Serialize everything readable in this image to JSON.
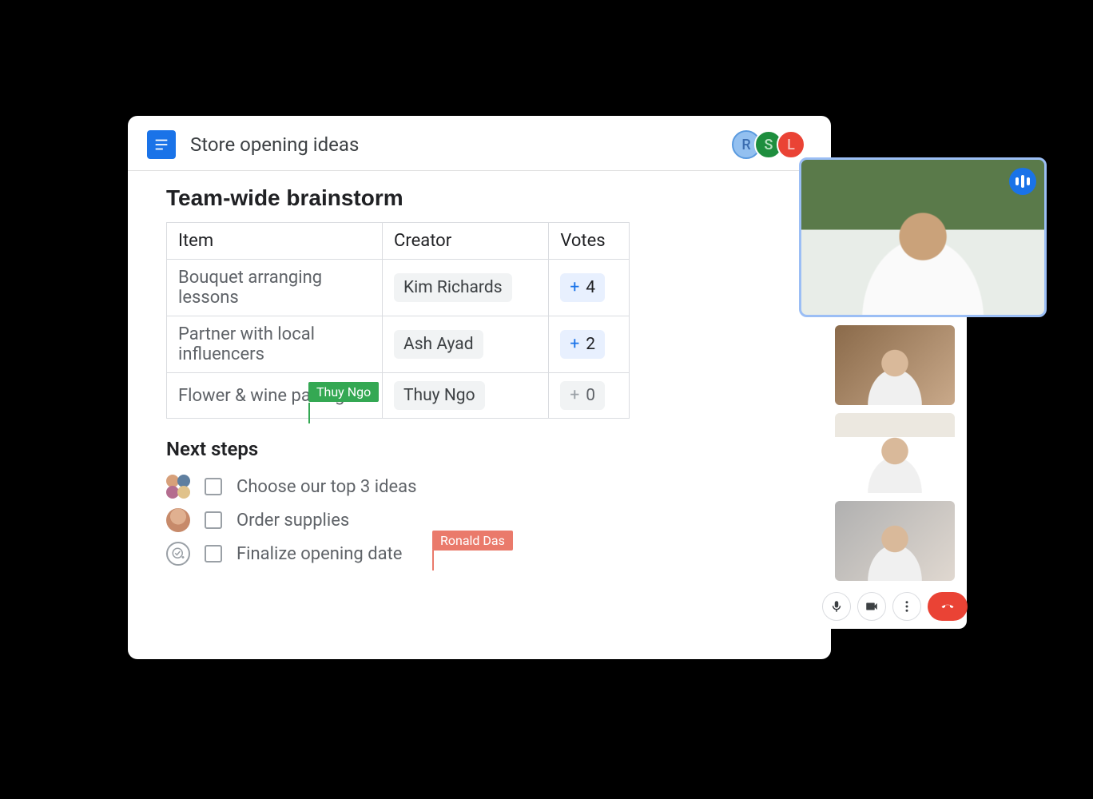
{
  "header": {
    "doc_title": "Store opening ideas",
    "collaborators": [
      {
        "initial": "R",
        "color": "r"
      },
      {
        "initial": "S",
        "color": "s"
      },
      {
        "initial": "L",
        "color": "l"
      }
    ]
  },
  "doc": {
    "section_title": "Team-wide brainstorm",
    "table": {
      "headers": {
        "item": "Item",
        "creator": "Creator",
        "votes": "Votes"
      },
      "rows": [
        {
          "item": "Bouquet arranging lessons",
          "creator": "Kim Richards",
          "votes": 4,
          "zero": false
        },
        {
          "item": "Partner with local influencers",
          "creator": "Ash Ayad",
          "votes": 2,
          "zero": false
        },
        {
          "item": "Flower & wine pairings",
          "creator": "Thuy Ngo",
          "votes": 0,
          "zero": true
        }
      ]
    },
    "cursors": {
      "green_name": "Thuy Ngo",
      "red_name": "Ronald Das"
    },
    "next_title": "Next steps",
    "next_items": [
      {
        "label": "Choose our top 3 ideas",
        "assignee": "multi"
      },
      {
        "label": "Order supplies",
        "assignee": "person"
      },
      {
        "label": "Finalize opening date",
        "assignee": "add"
      }
    ]
  },
  "call": {
    "controls": {
      "mic": "mic-icon",
      "cam": "camera-icon",
      "more": "more-icon",
      "end": "hangup-icon"
    }
  }
}
